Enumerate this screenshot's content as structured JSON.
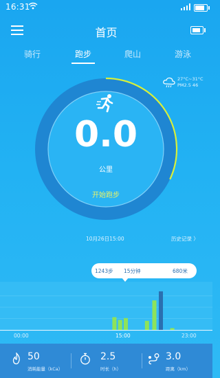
{
  "status_bar": {
    "time": "16:31"
  },
  "header": {
    "title": "首页"
  },
  "tabs": [
    {
      "label": "骑行",
      "active": false
    },
    {
      "label": "跑步",
      "active": true
    },
    {
      "label": "爬山",
      "active": false
    },
    {
      "label": "游泳",
      "active": false
    }
  ],
  "weather": {
    "temp": "27°C~31°C",
    "pm": "PM2.5 46",
    "icon": "cloud-rain-icon"
  },
  "dial": {
    "value": "0.0",
    "unit": "公里",
    "start_label": "开始跑步",
    "progress": 0.32,
    "icon": "runner-icon"
  },
  "chart_header": {
    "date": "10月26日15:00",
    "history": "历史记录 〉"
  },
  "tooltip": {
    "steps": "1243步",
    "duration": "15分钟",
    "distance": "680米"
  },
  "chart_data": {
    "type": "bar",
    "x_labels": [
      "00:00",
      "15:00",
      "23:00"
    ],
    "series": [
      {
        "values": [
          0,
          0,
          0,
          0,
          0,
          0,
          0,
          0,
          0,
          0,
          0,
          0,
          0,
          0,
          0,
          0,
          0,
          0,
          0,
          0,
          0,
          0,
          0,
          0,
          0,
          0,
          0,
          0,
          0,
          0,
          0,
          0,
          0,
          0,
          0,
          0,
          0,
          0,
          0,
          0,
          0,
          0,
          0,
          0,
          0,
          0,
          0,
          0,
          0,
          0,
          0,
          0,
          0,
          0,
          0,
          0,
          0,
          0,
          0,
          0,
          0,
          0,
          0,
          0,
          0,
          0,
          0,
          0,
          0,
          0,
          0,
          0,
          0,
          0,
          0,
          0,
          0,
          0,
          0,
          0,
          0,
          0,
          0,
          0,
          0,
          0,
          0,
          0,
          0,
          0,
          0,
          0,
          0,
          0,
          0,
          0
        ]
      }
    ],
    "bars": [
      {
        "hour": 12.5,
        "value": 0.28,
        "color": "#8ee35a"
      },
      {
        "hour": 13.2,
        "value": 0.22,
        "color": "#8ee35a"
      },
      {
        "hour": 13.9,
        "value": 0.26,
        "color": "#8ee35a"
      },
      {
        "hour": 16.5,
        "value": 0.2,
        "color": "#8ee35a"
      },
      {
        "hour": 17.4,
        "value": 0.65,
        "color": "#8ee35a"
      },
      {
        "hour": 18.2,
        "value": 0.85,
        "color": "#2a6fb0"
      },
      {
        "hour": 19.6,
        "value": 0.04,
        "color": "#8ee35a"
      }
    ],
    "gridlines": true
  },
  "stats": [
    {
      "value": "50",
      "label": "消耗能量（kCa）",
      "icon": "flame-icon"
    },
    {
      "value": "2.5",
      "label": "时长（h）",
      "icon": "stopwatch-icon"
    },
    {
      "value": "3.0",
      "label": "距离（km）",
      "icon": "route-icon"
    }
  ]
}
